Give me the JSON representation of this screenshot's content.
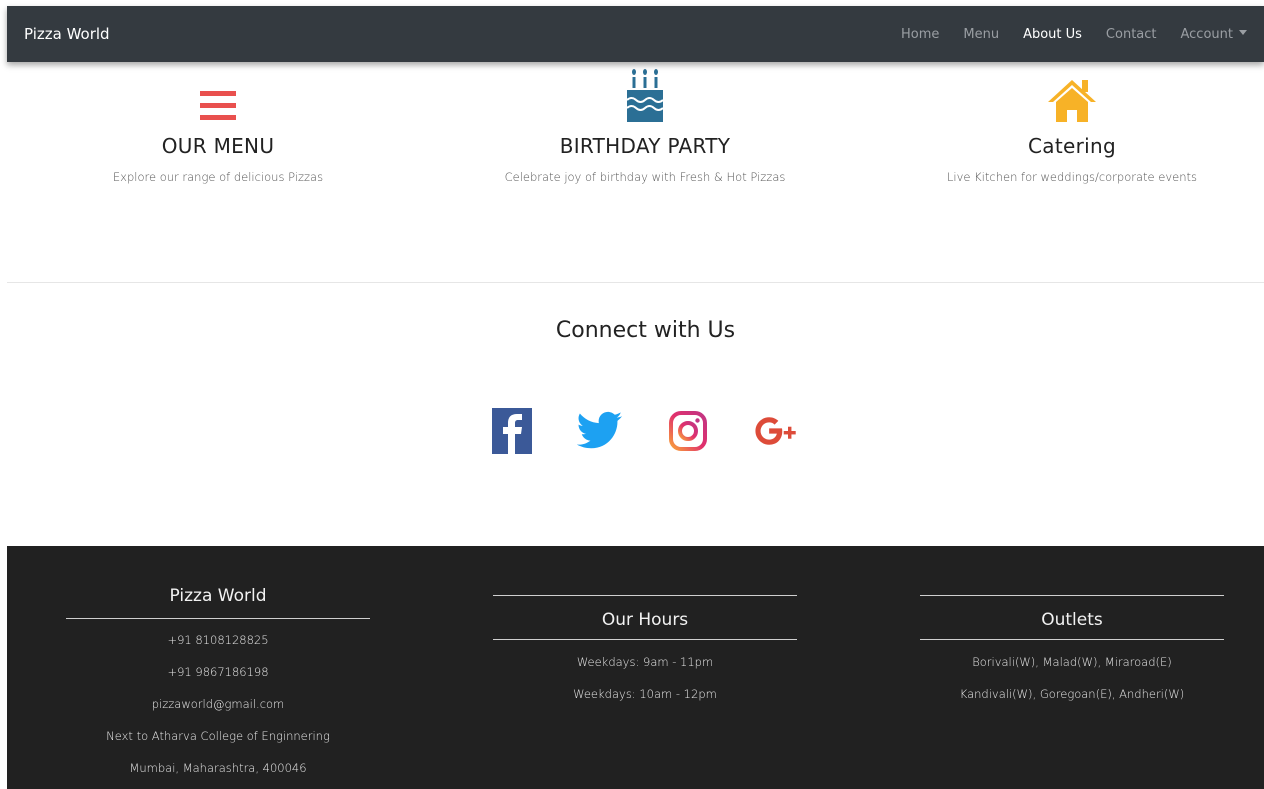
{
  "navbar": {
    "brand": "Pizza World",
    "items": [
      {
        "label": "Home",
        "active": false
      },
      {
        "label": "Menu",
        "active": false
      },
      {
        "label": "About Us",
        "active": true
      },
      {
        "label": "Contact",
        "active": false
      },
      {
        "label": "Account",
        "active": false,
        "dropdown": true
      }
    ]
  },
  "features": [
    {
      "icon": "menu-list-icon",
      "title": "OUR MENU",
      "text": "Explore our range of delicious Pizzas",
      "color": "#e9504e"
    },
    {
      "icon": "birthday-cake-icon",
      "title": "BIRTHDAY PARTY",
      "text": "Celebrate joy of birthday with Fresh & Hot Pizzas",
      "color": "#2b6f95"
    },
    {
      "icon": "house-icon",
      "title": "Catering",
      "text": "Live Kitchen for weddings/corporate events",
      "color": "#f7b227"
    }
  ],
  "connect": {
    "title": "Connect with Us",
    "icons": [
      {
        "name": "facebook-icon",
        "color": "#3b5998"
      },
      {
        "name": "twitter-icon",
        "color": "#1da1f2"
      },
      {
        "name": "instagram-icon",
        "color": "#e1306c"
      },
      {
        "name": "google-plus-icon",
        "color": "#dd4b39"
      }
    ]
  },
  "footer": {
    "contact": {
      "title": "Pizza World",
      "lines": [
        "+91 8108128825",
        "+91 9867186198",
        "pizzaworld@gmail.com",
        "Next to Atharva College of Enginnering",
        "Mumbai, Maharashtra, 400046"
      ]
    },
    "hours": {
      "title": "Our Hours",
      "lines": [
        "Weekdays: 9am - 11pm",
        "Weekdays: 10am - 12pm"
      ]
    },
    "outlets": {
      "title": "Outlets",
      "lines": [
        "Borivali(W), Malad(W), Miraroad(E)",
        "Kandivali(W), Goregoan(E), Andheri(W)"
      ]
    }
  }
}
